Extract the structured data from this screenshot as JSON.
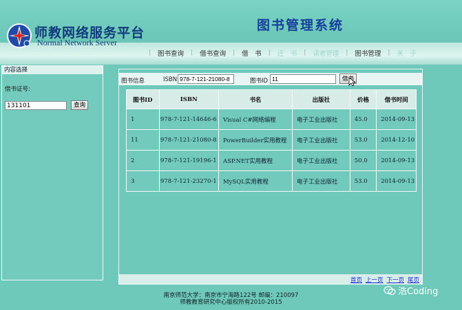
{
  "brand": {
    "name_cn": "师教网络服务平台",
    "name_en": "Normal Network Server",
    "system_title": "图书管理系统"
  },
  "nav": {
    "items": [
      {
        "label": "图书查询",
        "dim": false
      },
      {
        "label": "借书查询",
        "dim": false
      },
      {
        "label": "借　书",
        "dim": false
      },
      {
        "label": "还　书",
        "dim": true
      },
      {
        "label": "读者管理",
        "dim": true
      },
      {
        "label": "图书管理",
        "dim": false
      },
      {
        "label": "关　于",
        "dim": true
      }
    ]
  },
  "sidebar": {
    "title": "内容选择",
    "card_label": "借书证号:",
    "card_value": "131101",
    "query_button": "查询"
  },
  "filter": {
    "section_label": "图书信息",
    "isbn_label": "ISBN",
    "isbn_value": "978-7-121-21080-8",
    "bookid_label": "图书ID",
    "bookid_value": "11",
    "borrow_button": "借书"
  },
  "table": {
    "headers": [
      "图书ID",
      "ISBN",
      "书名",
      "出版社",
      "价格",
      "借书时间"
    ],
    "rows": [
      [
        "1",
        "978-7-121-14646-6",
        "Visual C#网络编程",
        "电子工业出版社",
        "45.0",
        "2014-09-13"
      ],
      [
        "11",
        "978-7-121-21080-8",
        "PowerBuilder实用教程",
        "电子工业出版社",
        "53.0",
        "2014-12-10"
      ],
      [
        "2",
        "978-7-121-19196-1",
        "ASP.NET实用教程",
        "电子工业出版社",
        "50.0",
        "2014-09-13"
      ],
      [
        "3",
        "978-7-121-23270-1",
        "MySQL实用教程",
        "电子工业出版社",
        "53.0",
        "2014-09-13"
      ]
    ]
  },
  "pager": {
    "first": "首页",
    "prev": "上一页",
    "next": "下一页",
    "last": "尾页"
  },
  "footer": {
    "line1": "南京师范大学：南京市宁海路122号 邮编：210097",
    "line2": "师教教育研究中心版权所有2010-2015"
  },
  "watermark": {
    "text": "浩Coding"
  },
  "colors": {
    "background": "#6fc9bb",
    "title_blue": "#173f9c",
    "link_blue": "#1a2bd6"
  }
}
